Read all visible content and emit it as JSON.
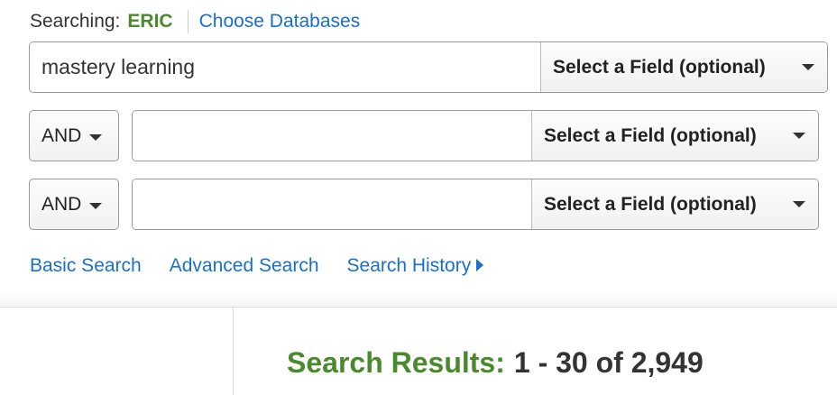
{
  "search": {
    "searching_label": "Searching:",
    "database": "ERIC",
    "choose_databases": "Choose Databases",
    "rows": [
      {
        "boolean": "",
        "value": "mastery learning",
        "field": "Select a Field (optional)"
      },
      {
        "boolean": "AND",
        "value": "",
        "field": "Select a Field (optional)"
      },
      {
        "boolean": "AND",
        "value": "",
        "field": "Select a Field (optional)"
      }
    ]
  },
  "links": {
    "basic_search": "Basic Search",
    "advanced_search": "Advanced Search",
    "search_history": "Search History"
  },
  "results": {
    "label": "Search Results:",
    "range": "1 - 30 of 2,949"
  },
  "colors": {
    "accent_green": "#4a8a2c",
    "link_blue": "#1a6fc9"
  }
}
